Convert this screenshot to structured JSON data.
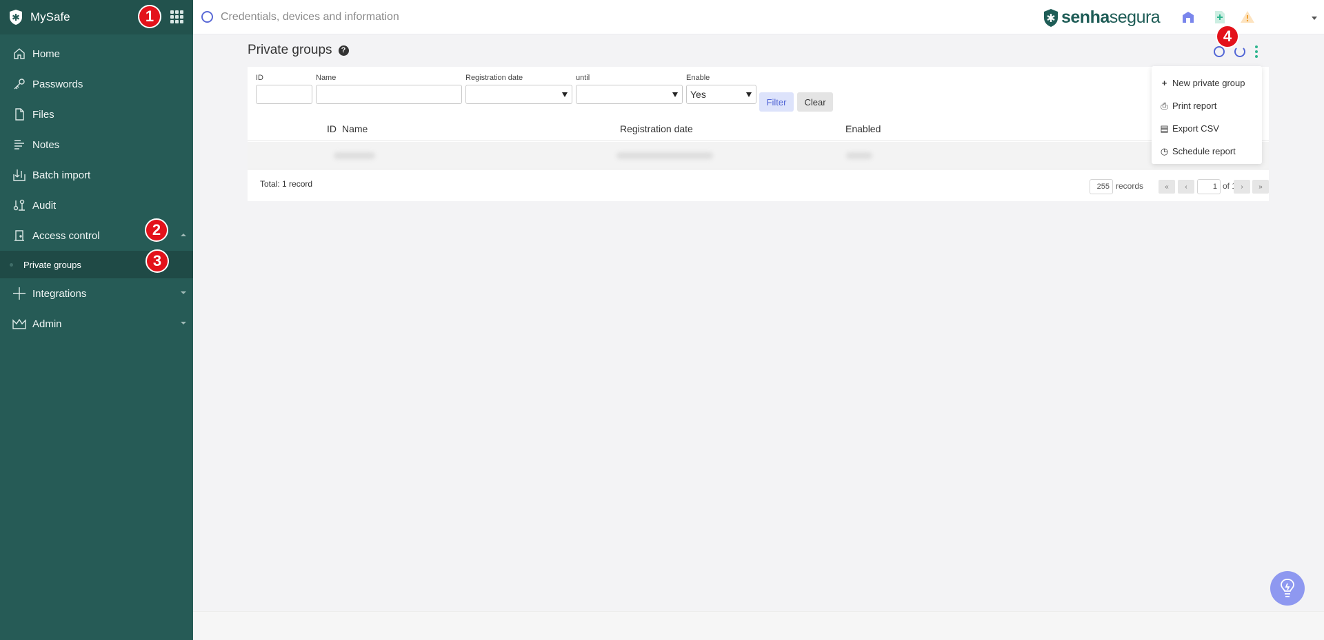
{
  "app": {
    "name": "MySafe"
  },
  "sidebar": {
    "items": [
      {
        "label": "Home",
        "icon": "home-icon"
      },
      {
        "label": "Passwords",
        "icon": "key-icon"
      },
      {
        "label": "Files",
        "icon": "file-icon"
      },
      {
        "label": "Notes",
        "icon": "notes-icon"
      },
      {
        "label": "Batch import",
        "icon": "import-icon"
      },
      {
        "label": "Audit",
        "icon": "audit-icon"
      },
      {
        "label": "Access control",
        "icon": "access-control-icon"
      },
      {
        "label": "Private groups"
      },
      {
        "label": "Integrations",
        "icon": "plus-icon"
      },
      {
        "label": "Admin",
        "icon": "crown-icon"
      }
    ]
  },
  "annotations": [
    "1",
    "2",
    "3",
    "4"
  ],
  "topbar": {
    "search_placeholder": "Credentials, devices and information",
    "brand_left": "senha",
    "brand_right": "segura",
    "brand_color": "#1e5c56"
  },
  "page": {
    "title": "Private groups",
    "help_glyph": "?"
  },
  "filters": {
    "id_label": "ID",
    "name_label": "Name",
    "reg_date_label": "Registration date",
    "until_label": "until",
    "enable_label": "Enable",
    "enable_value": "Yes",
    "filter_button": "Filter",
    "clear_button": "Clear"
  },
  "table": {
    "columns": [
      "ID",
      "Name",
      "Registration date",
      "Enabled"
    ]
  },
  "footer": {
    "total": "Total: 1 record",
    "page_size": "255",
    "records_label": "records",
    "first": "«",
    "prev": "‹",
    "page": "1",
    "of_label": "of 1",
    "next": "›",
    "last": "»"
  },
  "menu": {
    "items": [
      {
        "label": "New private group",
        "glyph": "+"
      },
      {
        "label": "Print report",
        "glyph": "⎙"
      },
      {
        "label": "Export CSV",
        "glyph": "▤"
      },
      {
        "label": "Schedule report",
        "glyph": "◷"
      }
    ]
  },
  "colors": {
    "sidebar": "#265b56",
    "accent": "#5266d6",
    "annotation": "#e3121b"
  }
}
